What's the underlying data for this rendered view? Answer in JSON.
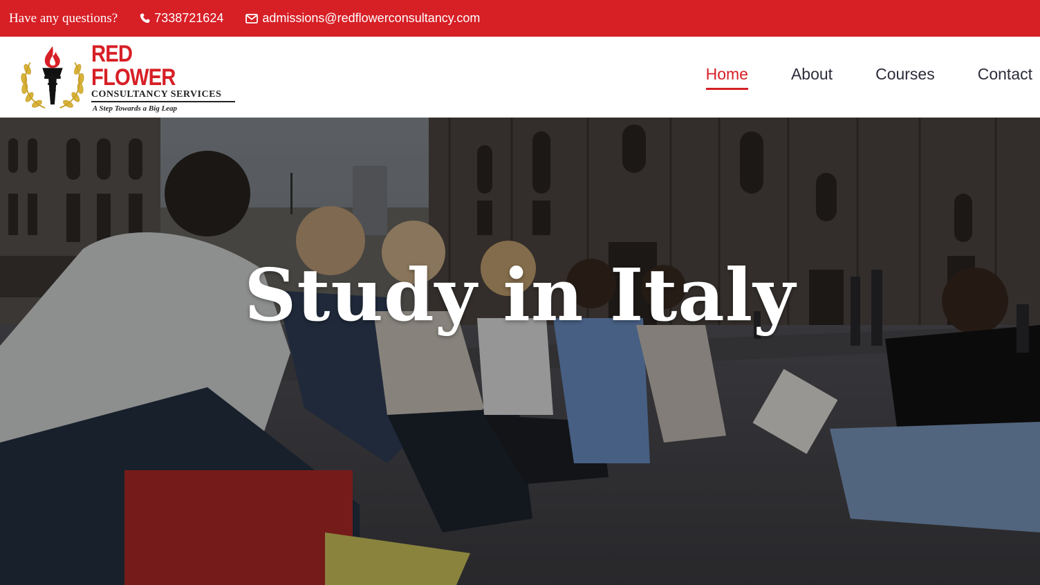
{
  "topbar": {
    "question": "Have any questions?",
    "phone": "7338721624",
    "email": "admissions@redflowerconsultancy.com",
    "icons": {
      "phone": "phone-icon",
      "email": "envelope-icon"
    }
  },
  "logo": {
    "title": "RED FLOWER",
    "subtitle": "CONSULTANCY SERVICES",
    "tagline": "A Step Towards a Big Leap"
  },
  "nav": {
    "items": [
      {
        "label": "Home",
        "active": true
      },
      {
        "label": "About",
        "active": false
      },
      {
        "label": "Courses",
        "active": false
      },
      {
        "label": "Contact",
        "active": false
      }
    ]
  },
  "hero": {
    "title": "Study in Italy"
  },
  "colors": {
    "brand_red": "#d71f26",
    "nav_text": "#2c2c3a",
    "white": "#ffffff"
  }
}
